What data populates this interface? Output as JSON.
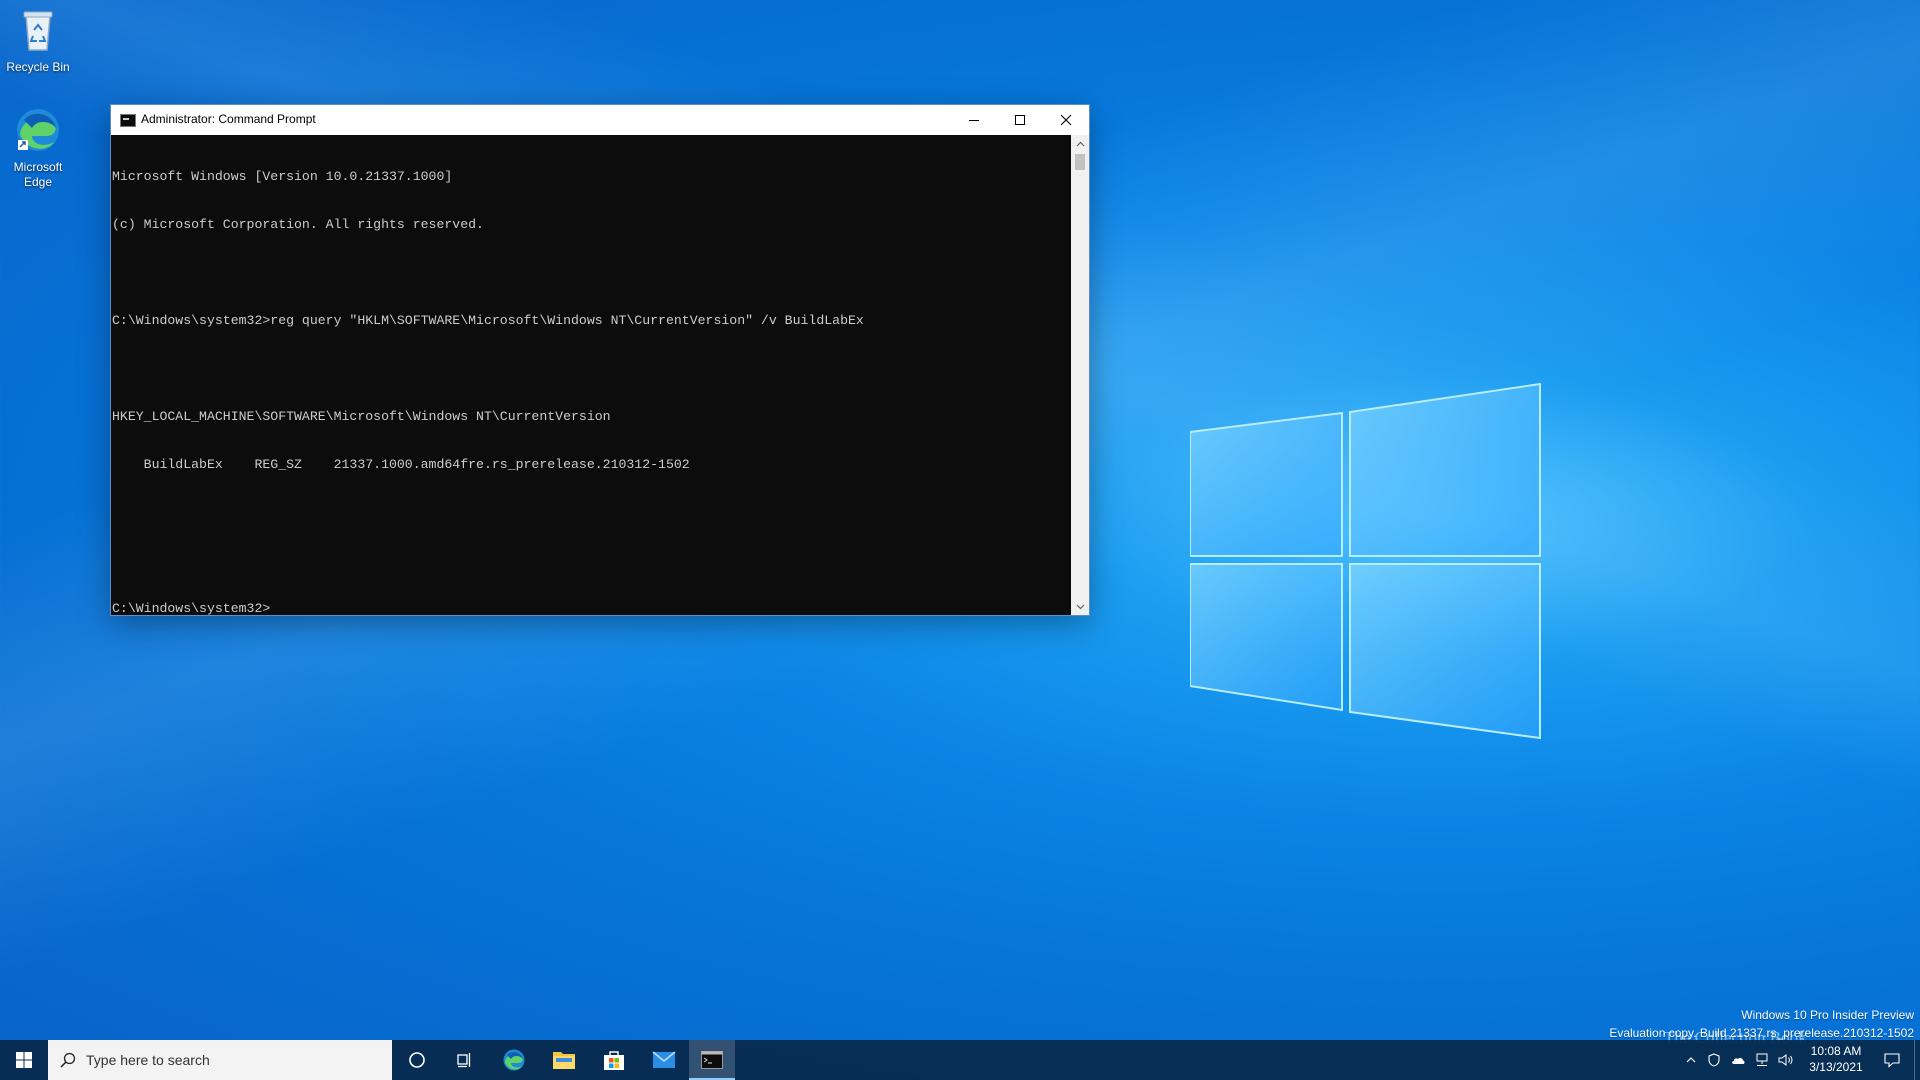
{
  "desktop": {
    "icons": [
      {
        "label": "Recycle Bin"
      },
      {
        "label": "Microsoft Edge"
      }
    ],
    "watermark": {
      "line1": "Windows 10 Pro Insider Preview",
      "line2": "Evaluation copy. Build 21337.rs_prerelease.210312-1502"
    },
    "brand": "The Collection Book"
  },
  "window": {
    "title": "Administrator: Command Prompt",
    "console_lines": [
      "Microsoft Windows [Version 10.0.21337.1000]",
      "(c) Microsoft Corporation. All rights reserved.",
      "",
      "C:\\Windows\\system32>reg query \"HKLM\\SOFTWARE\\Microsoft\\Windows NT\\CurrentVersion\" /v BuildLabEx",
      "",
      "HKEY_LOCAL_MACHINE\\SOFTWARE\\Microsoft\\Windows NT\\CurrentVersion",
      "    BuildLabEx    REG_SZ    21337.1000.amd64fre.rs_prerelease.210312-1502",
      "",
      "",
      "C:\\Windows\\system32>"
    ]
  },
  "taskbar": {
    "search_placeholder": "Type here to search",
    "pinned": [
      "Cortana",
      "Task View",
      "Microsoft Edge",
      "File Explorer",
      "Microsoft Store",
      "Mail",
      "Command Prompt"
    ],
    "clock": {
      "time": "10:08 AM",
      "date": "3/13/2021"
    }
  },
  "colors": {
    "console_bg": "#0c0c0c",
    "console_fg": "#cccccc",
    "taskbar_bg": "#08284a",
    "accent": "#0078d7"
  }
}
